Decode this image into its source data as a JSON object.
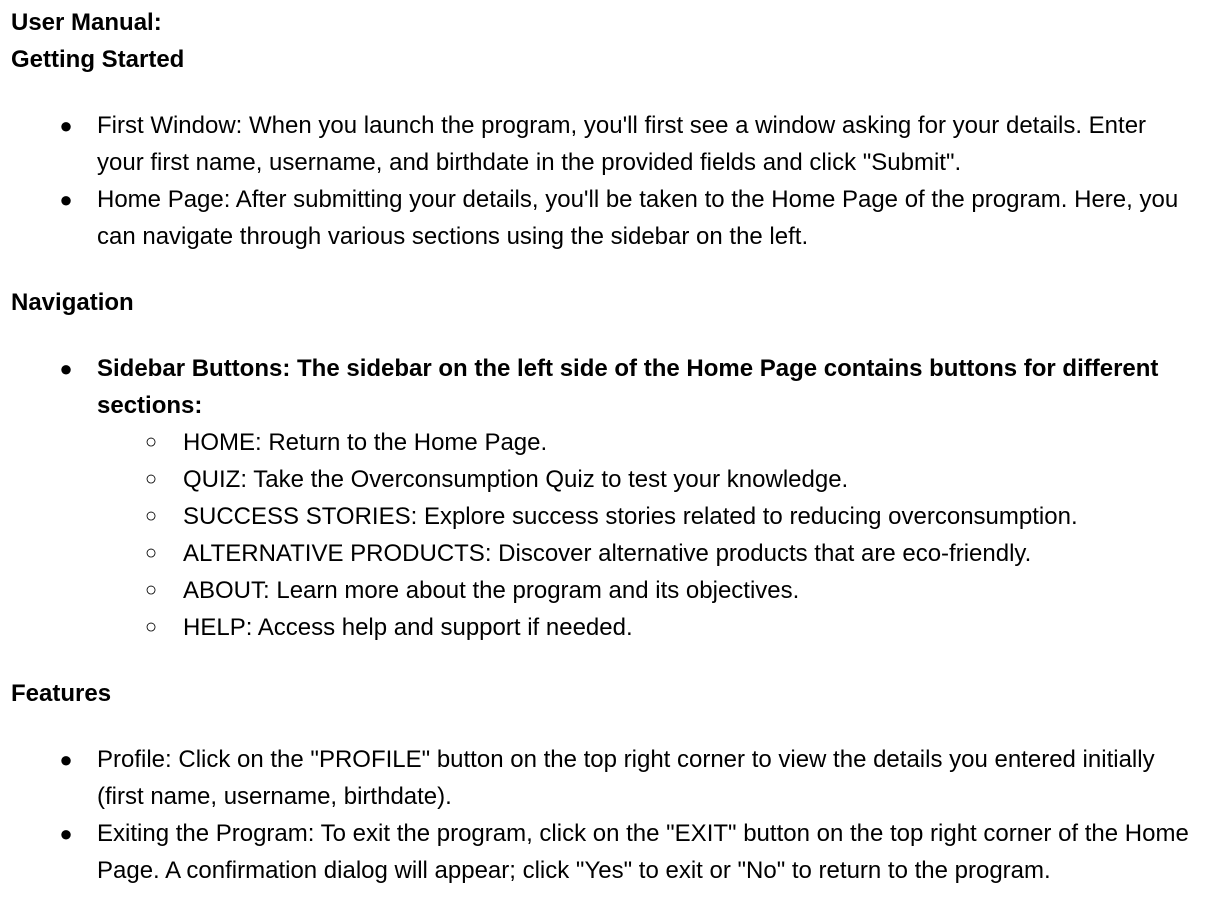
{
  "manual_title": "User Manual:",
  "getting_started": {
    "heading": "Getting Started",
    "items": [
      "First Window: When you launch the program, you'll first see a window asking for your details. Enter your first name, username, and birthdate in the provided fields and click \"Submit\".",
      "Home Page: After submitting your details, you'll be taken to the Home Page of the program. Here, you can navigate through various sections using the sidebar on the left."
    ]
  },
  "navigation": {
    "heading": "Navigation",
    "sidebar_item": "Sidebar Buttons: The sidebar on the left side of the Home Page contains buttons for different sections:",
    "sub_items": [
      "HOME: Return to the Home Page.",
      "QUIZ: Take the Overconsumption Quiz to test your knowledge.",
      "SUCCESS STORIES: Explore success stories related to reducing overconsumption.",
      "ALTERNATIVE PRODUCTS: Discover alternative products that are eco-friendly.",
      "ABOUT: Learn more about the program and its objectives.",
      "HELP: Access help and support if needed."
    ]
  },
  "features": {
    "heading": "Features",
    "items": [
      "Profile: Click on the \"PROFILE\" button on the top right corner to view the details you entered initially (first name, username, birthdate).",
      "Exiting the Program: To exit the program, click on the \"EXIT\" button on the top right corner of the Home Page. A confirmation dialog will appear; click \"Yes\" to exit or \"No\" to return to the program."
    ]
  },
  "bullet_glyphs": {
    "filled": "●",
    "hollow": "○"
  }
}
